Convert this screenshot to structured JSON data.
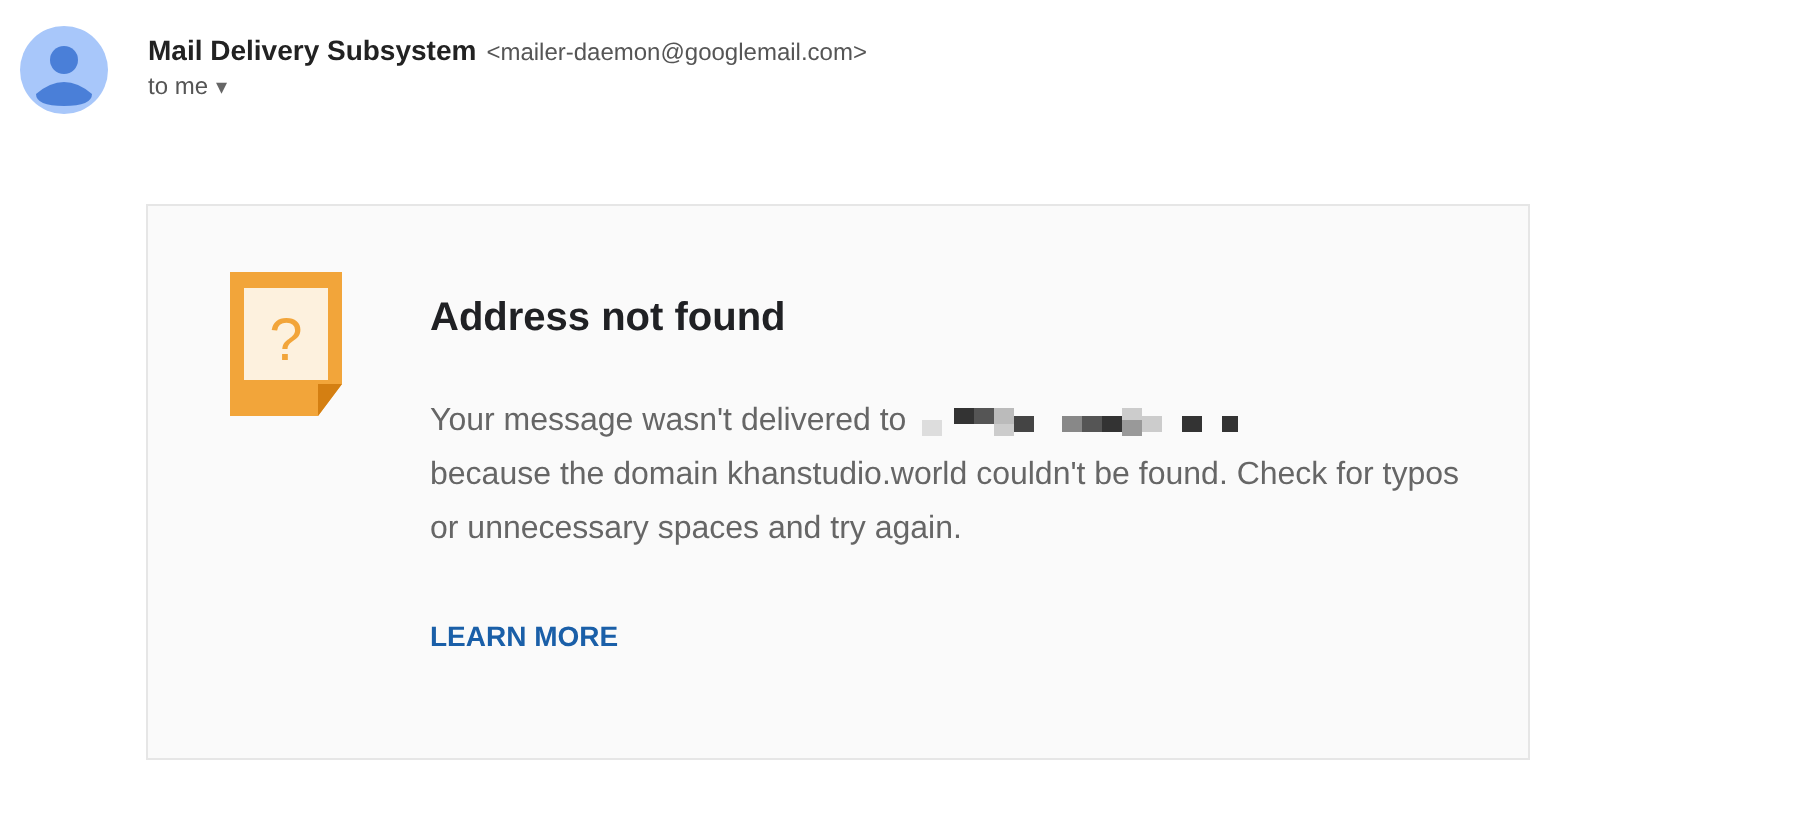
{
  "sender": {
    "name": "Mail Delivery Subsystem",
    "address": "<mailer-daemon@googlemail.com>",
    "recipient": "to me",
    "recipient_caret": "▾"
  },
  "notice": {
    "icon_glyph": "?",
    "title": "Address not found",
    "message_start": "Your message wasn't delivered to",
    "message_end": "because the domain khanstudio.world couldn't be found. Check for typos or unnecessary spaces and try again.",
    "link": "LEARN MORE"
  }
}
